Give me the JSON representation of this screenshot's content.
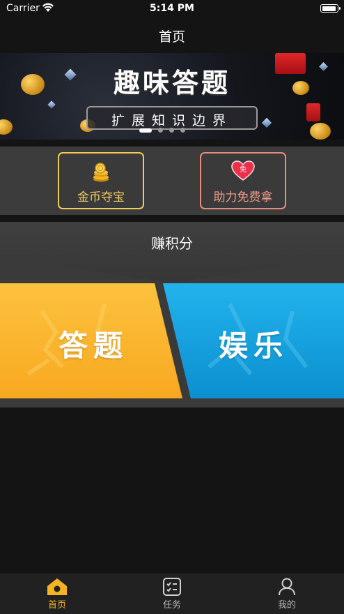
{
  "status_bar": {
    "carrier": "Carrier",
    "time": "5:14 PM"
  },
  "nav": {
    "title": "首页"
  },
  "banner": {
    "title": "趣味答题",
    "subtitle": "扩展知识边界",
    "page_count": 4,
    "active_page": 1
  },
  "cards": [
    {
      "label": "金币夺宝",
      "icon": "gold-coins-icon",
      "border_color": "#f3cb55"
    },
    {
      "label": "助力免费拿",
      "icon": "heart-free-icon",
      "border_color": "#e88e7c",
      "badge": "免"
    }
  ],
  "earn": {
    "title": "赚积分",
    "tiles": [
      {
        "label": "答题",
        "color": "#fbb530"
      },
      {
        "label": "娱乐",
        "color": "#1aa7e0"
      }
    ]
  },
  "tabs": [
    {
      "label": "首页",
      "icon": "home-icon",
      "active": true
    },
    {
      "label": "任务",
      "icon": "task-icon",
      "active": false
    },
    {
      "label": "我的",
      "icon": "profile-icon",
      "active": false
    }
  ],
  "colors": {
    "accent": "#f5b321",
    "background": "#141414"
  }
}
